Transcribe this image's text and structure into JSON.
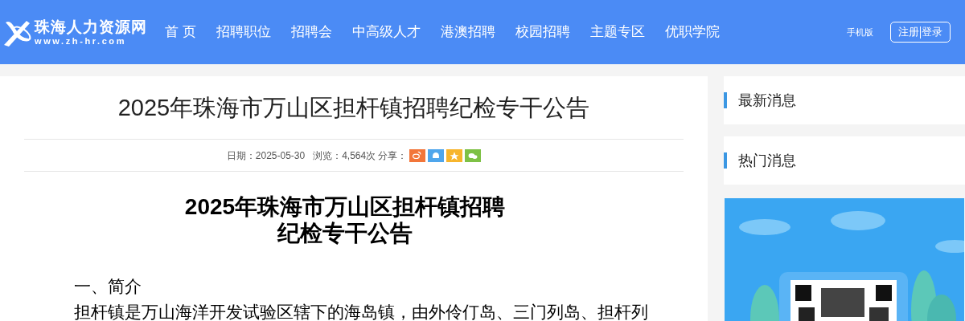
{
  "header": {
    "logo": {
      "name": "珠海人力资源网",
      "url": "www.zh-hr.com"
    },
    "nav": [
      {
        "label": "首 页"
      },
      {
        "label": "招聘职位"
      },
      {
        "label": "招聘会"
      },
      {
        "label": "中高级人才"
      },
      {
        "label": "港澳招聘"
      },
      {
        "label": "校园招聘"
      },
      {
        "label": "主题专区"
      },
      {
        "label": "优职学院"
      }
    ],
    "mobile_link": "手机版",
    "register": "注册",
    "login": "登录"
  },
  "article": {
    "title": "2025年珠海市万山区担杆镇招聘纪检专干公告",
    "meta": {
      "date": "日期：2025-05-30",
      "views": "浏览：4,564次",
      "share": "分享："
    },
    "share_buttons": [
      {
        "kind": "weibo",
        "color": "#f2763a"
      },
      {
        "kind": "qq",
        "color": "#4fa6ec"
      },
      {
        "kind": "qzone",
        "color": "#f7b52c"
      },
      {
        "kind": "wechat",
        "color": "#7ec146"
      }
    ],
    "heading": [
      "2025年珠海市万山区担杆镇招聘",
      "纪检专干公告"
    ],
    "section": "一、简介",
    "paragraph": "担杆镇是万山海洋开发试验区辖下的海岛镇，由外伶仃岛、三门列岛、担杆列"
  },
  "sidebar": {
    "panels": [
      {
        "title": "最新消息"
      },
      {
        "title": "热门消息"
      }
    ]
  }
}
